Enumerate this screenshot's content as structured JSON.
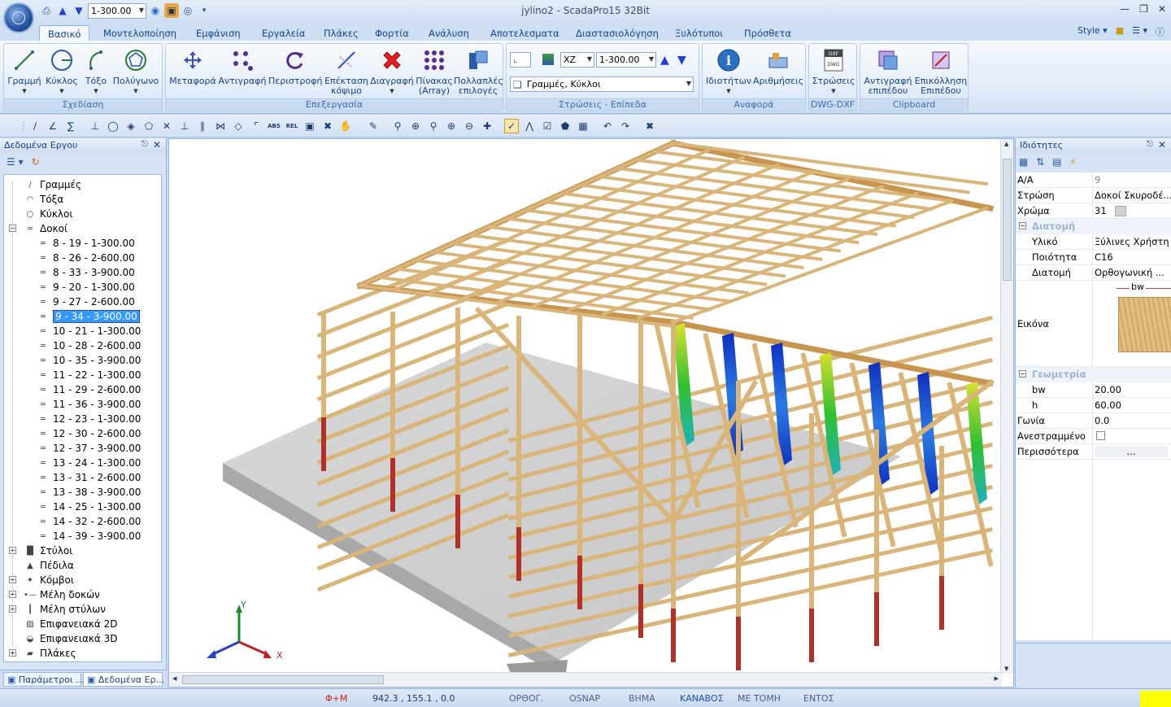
{
  "window": {
    "title": "jylino2 - ScadaPro15 32Bit",
    "qat_value": "1-300.00"
  },
  "tabs": [
    "Βασικό",
    "Μοντελοποίηση",
    "Εμφάνιση",
    "Εργαλεία",
    "Πλάκες",
    "Φορτία",
    "Ανάλυση",
    "Αποτελεσματα",
    "Διαστασιολόγηση",
    "Ξυλότυποι",
    "Πρόσθετα"
  ],
  "style_label": "Style",
  "ribbon": {
    "groups": {
      "design": "Σχεδίαση",
      "edit": "Επεξεργασία",
      "layers": "Στρώσεις - Επίπεδα",
      "report": "Αναφορά",
      "dwg": "DWG-DXF",
      "clipboard": "Clipboard"
    },
    "design_buttons": [
      "Γραμμή",
      "Κύκλος",
      "Τόξο",
      "Πολύγωνο"
    ],
    "edit_buttons": [
      "Μεταφορά",
      "Αντιγραφή",
      "Περιστροφή",
      "Επέκταση\nκόψιμο",
      "Διαγραφή",
      "Πίνακας\n(Array)",
      "Πολλαπλές\nεπιλογές"
    ],
    "plane_combo": "XZ",
    "level_combo": "1-300.00",
    "layer_combo": "Γραμμές, Κύκλοι",
    "report_buttons": [
      "Ιδιοτήτων",
      "Αριθμήσεις"
    ],
    "dwg_buttons": [
      "Στρώσεις"
    ],
    "clipboard_buttons": [
      "Αντιγραφή\nεπιπέδου",
      "Επικόλληση\nΕπιπέδου"
    ]
  },
  "left_panel": {
    "title": "Δεδομένα Εργου",
    "tree": [
      {
        "label": "Γραμμές",
        "icon": "line-icon",
        "level": 1
      },
      {
        "label": "Τόξα",
        "icon": "arc-icon",
        "level": 1
      },
      {
        "label": "Κύκλοι",
        "icon": "circle-icon",
        "level": 1
      },
      {
        "label": "Δοκοί",
        "icon": "beam-icon",
        "level": 1,
        "expanded": true
      },
      {
        "label": "8 - 19 - 1-300.00",
        "icon": "beam-icon",
        "level": 2
      },
      {
        "label": "8 - 26 - 2-600.00",
        "icon": "beam-icon",
        "level": 2
      },
      {
        "label": "8 - 33 - 3-900.00",
        "icon": "beam-icon",
        "level": 2
      },
      {
        "label": "9 - 20 - 1-300.00",
        "icon": "beam-icon",
        "level": 2
      },
      {
        "label": "9 - 27 - 2-600.00",
        "icon": "beam-icon",
        "level": 2
      },
      {
        "label": "9 - 34 - 3-900.00",
        "icon": "beam-icon",
        "level": 2,
        "selected": true
      },
      {
        "label": "10 - 21 - 1-300.00",
        "icon": "beam-icon",
        "level": 2
      },
      {
        "label": "10 - 28 - 2-600.00",
        "icon": "beam-icon",
        "level": 2
      },
      {
        "label": "10 - 35 - 3-900.00",
        "icon": "beam-icon",
        "level": 2
      },
      {
        "label": "11 - 22 - 1-300.00",
        "icon": "beam-icon",
        "level": 2
      },
      {
        "label": "11 - 29 - 2-600.00",
        "icon": "beam-icon",
        "level": 2
      },
      {
        "label": "11 - 36 - 3-900.00",
        "icon": "beam-icon",
        "level": 2
      },
      {
        "label": "12 - 23 - 1-300.00",
        "icon": "beam-icon",
        "level": 2
      },
      {
        "label": "12 - 30 - 2-600.00",
        "icon": "beam-icon",
        "level": 2
      },
      {
        "label": "12 - 37 - 3-900.00",
        "icon": "beam-icon",
        "level": 2
      },
      {
        "label": "13 - 24 - 1-300.00",
        "icon": "beam-icon",
        "level": 2
      },
      {
        "label": "13 - 31 - 2-600.00",
        "icon": "beam-icon",
        "level": 2
      },
      {
        "label": "13 - 38 - 3-900.00",
        "icon": "beam-icon",
        "level": 2
      },
      {
        "label": "14 - 25 - 1-300.00",
        "icon": "beam-icon",
        "level": 2
      },
      {
        "label": "14 - 32 - 2-600.00",
        "icon": "beam-icon",
        "level": 2
      },
      {
        "label": "14 - 39 - 3-900.00",
        "icon": "beam-icon",
        "level": 2
      },
      {
        "label": "Στύλοι",
        "icon": "column-icon",
        "level": 1,
        "collapsed": true
      },
      {
        "label": "Πέδιλα",
        "icon": "footing-icon",
        "level": 1
      },
      {
        "label": "Κόμβοι",
        "icon": "node-icon",
        "level": 1,
        "collapsed": true
      },
      {
        "label": "Μέλη δοκών",
        "icon": "beam-member-icon",
        "level": 1,
        "collapsed": true
      },
      {
        "label": "Μέλη στύλων",
        "icon": "column-member-icon",
        "level": 1,
        "collapsed": true
      },
      {
        "label": "Επιφανειακά 2D",
        "icon": "surface-2d-icon",
        "level": 1
      },
      {
        "label": "Επιφανειακά 3D",
        "icon": "surface-3d-icon",
        "level": 1
      },
      {
        "label": "Πλάκες",
        "icon": "slab-icon",
        "level": 1,
        "collapsed": true
      }
    ],
    "bottom_tabs": [
      "Παράμετροι ...",
      "Δεδομένα Ερ..."
    ]
  },
  "right_panel": {
    "title": "Ιδιότητες",
    "rows": {
      "aa": {
        "k": "A/A",
        "v": "9"
      },
      "layer": {
        "k": "Στρώση",
        "v": "Δοκοί Σκυροδέ..."
      },
      "color": {
        "k": "Χρώμα",
        "v": "31"
      },
      "cat_section": "Διατομή",
      "material": {
        "k": "Υλικό",
        "v": "Ξύλινες Χρήστη"
      },
      "quality": {
        "k": "Ποιότητα",
        "v": "C16"
      },
      "section": {
        "k": "Διατομή",
        "v": "Ορθογωνική ..."
      },
      "image": {
        "k": "Εικόνα",
        "v": "bw"
      },
      "cat_geometry": "Γεωμετρία",
      "bw": {
        "k": "bw",
        "v": "20.00"
      },
      "h": {
        "k": "h",
        "v": "60.00"
      },
      "angle": {
        "k": "Γωνία",
        "v": "0.0"
      },
      "inverted": {
        "k": "Ανεστραμμένο",
        "v": ""
      },
      "more": {
        "k": "Περισσότερα",
        "v": "..."
      }
    }
  },
  "axes": {
    "x": "X",
    "y": "Y"
  },
  "status": {
    "phi_m": "Φ+Μ",
    "coords": "942.3 , 155.1 , 0.0",
    "ortho": "ΟΡΘΟΓ.",
    "osnap": "OSNAP",
    "step": "ΒΗΜΑ",
    "grid": "ΚΑΝΑΒΟΣ",
    "section_cut": "ΜΕ ΤΟΜΗ",
    "inside": "ΕΝΤΟΣ"
  },
  "colors": {
    "ribbon_accent": "#15428b",
    "selection": "#3399ff",
    "timber": "#d9b57a",
    "steel_column": "#b0302a",
    "status_active": "#1e4fa0",
    "status_red": "#d02020"
  }
}
